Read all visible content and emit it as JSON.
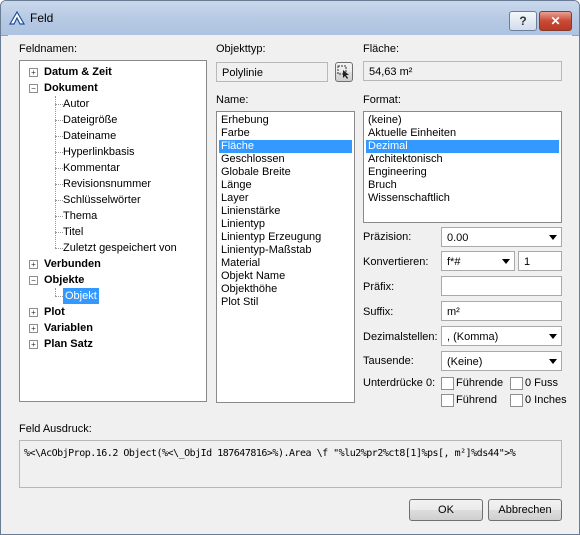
{
  "window": {
    "title": "Feld"
  },
  "titlebar": {
    "help_glyph": "?",
    "close_glyph": "✕"
  },
  "fieldnames": {
    "label": "Feldnamen:",
    "tree": [
      {
        "label": "Datum & Zeit",
        "bold": true,
        "expand": "+"
      },
      {
        "label": "Dokument",
        "bold": true,
        "expand": "−"
      },
      {
        "label": "Autor"
      },
      {
        "label": "Dateigröße"
      },
      {
        "label": "Dateiname"
      },
      {
        "label": "Hyperlinkbasis"
      },
      {
        "label": "Kommentar"
      },
      {
        "label": "Revisionsnummer"
      },
      {
        "label": "Schlüsselwörter"
      },
      {
        "label": "Thema"
      },
      {
        "label": "Titel"
      },
      {
        "label": "Zuletzt gespeichert von"
      },
      {
        "label": "Verbunden",
        "bold": true,
        "expand": "+"
      },
      {
        "label": "Objekte",
        "bold": true,
        "expand": "−"
      },
      {
        "label": "Objekt",
        "selected": true
      },
      {
        "label": "Plot",
        "bold": true,
        "expand": "+"
      },
      {
        "label": "Variablen",
        "bold": true,
        "expand": "+"
      },
      {
        "label": "Plan Satz",
        "bold": true,
        "expand": "+"
      }
    ]
  },
  "objecttype": {
    "label": "Objekttyp:",
    "value": "Polylinie"
  },
  "name": {
    "label": "Name:",
    "items": [
      "Erhebung",
      "Farbe",
      "Fläche",
      "Geschlossen",
      "Globale Breite",
      "Länge",
      "Layer",
      "Linienstärke",
      "Linientyp",
      "Linientyp Erzeugung",
      "Linientyp-Maßstab",
      "Material",
      "Objekt Name",
      "Objekthöhe",
      "Plot Stil"
    ],
    "selected_index": 2
  },
  "area": {
    "label": "Fläche:",
    "value": "54,63 m²"
  },
  "format": {
    "label": "Format:",
    "items": [
      "(keine)",
      "Aktuelle Einheiten",
      "Dezimal",
      "Architektonisch",
      "Engineering",
      "Bruch",
      "Wissenschaftlich"
    ],
    "selected_index": 2
  },
  "precision": {
    "label": "Präzision:",
    "value": "0.00"
  },
  "convert": {
    "label": "Konvertieren:",
    "value": "f*#",
    "factor": "1"
  },
  "prefix": {
    "label": "Präfix:",
    "value": ""
  },
  "suffix": {
    "label": "Suffix:",
    "value": "m²"
  },
  "decimal_sep": {
    "label": "Dezimalstellen:",
    "value": ", (Komma)"
  },
  "thousands": {
    "label": "Tausende:",
    "value": "(Keine)"
  },
  "suppress": {
    "label": "Unterdrücke 0:",
    "leading_top": "Führende",
    "feet": "0 Fuss",
    "leading_bottom": "Führend",
    "inches": "0 Inches"
  },
  "expression": {
    "label": "Feld Ausdruck:",
    "value": "%<\\AcObjProp.16.2 Object(%<\\_ObjId 187647816>%).Area \\f \"%lu2%pr2%ct8[1]%ps[, m²]%ds44\">%"
  },
  "buttons": {
    "ok": "OK",
    "cancel": "Abbrechen"
  }
}
